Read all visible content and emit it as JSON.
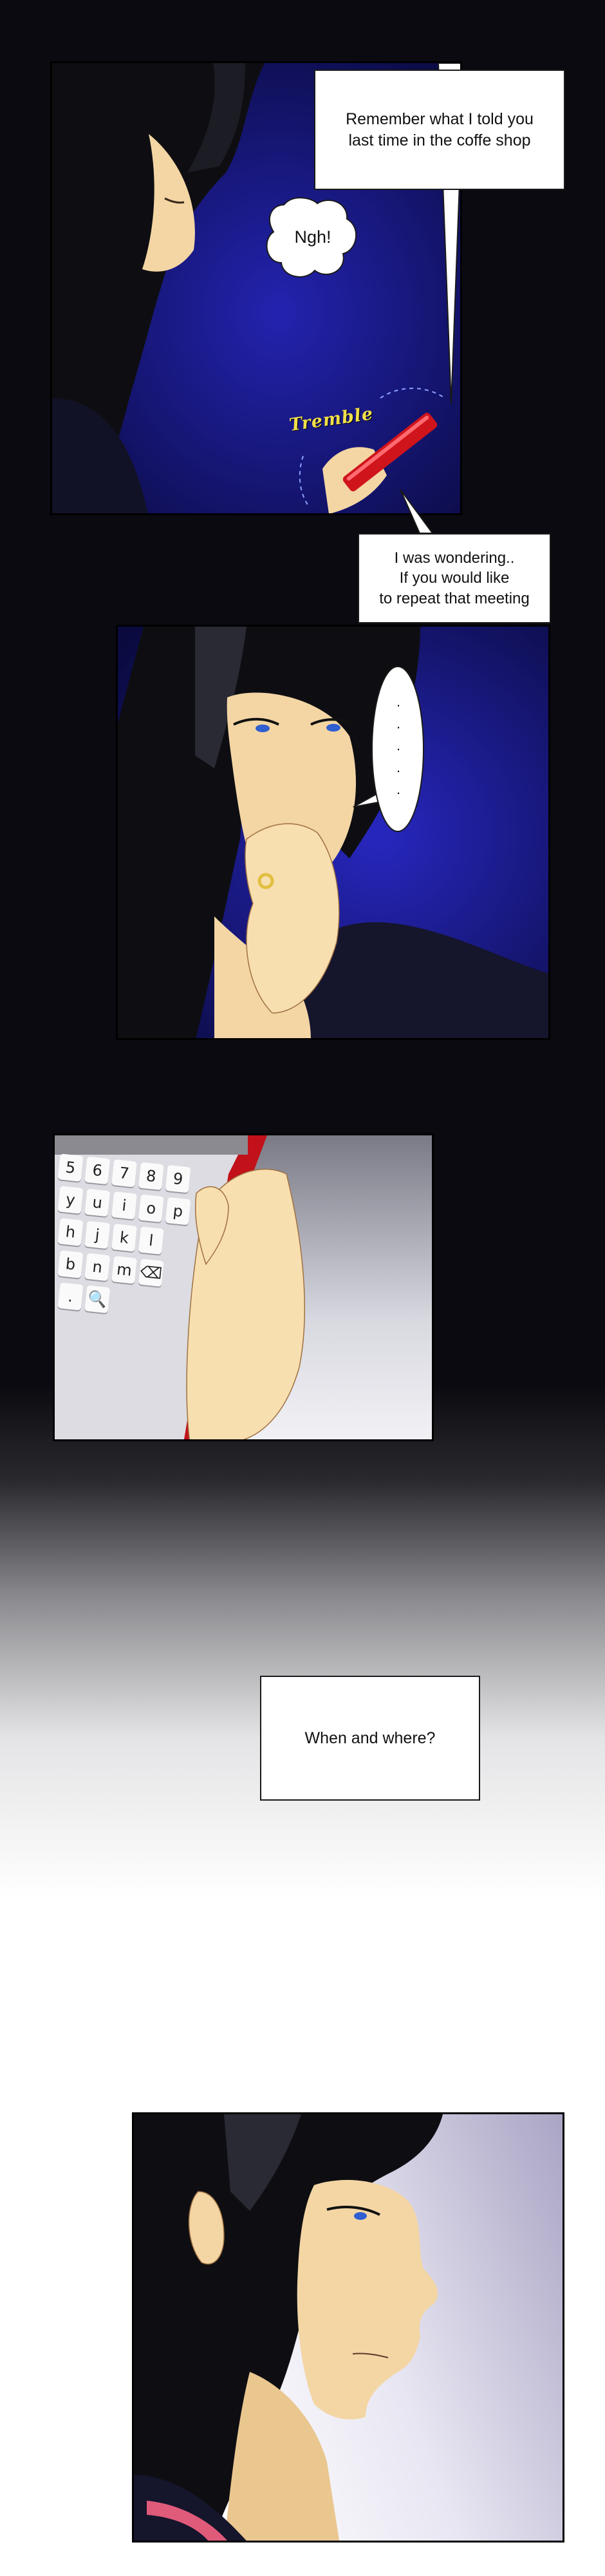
{
  "panel1": {
    "caption": "Remember what I told you\nlast time in the coffe shop",
    "speech": "Ngh!",
    "sfx": "Tremble"
  },
  "caption2": "I was wondering..\nIf you would like\nto repeat that meeting",
  "panel2": {
    "speech": ".\n.\n.\n.\n."
  },
  "panel3": {
    "keyboard_rows": [
      [
        "5",
        "6",
        "7",
        "8",
        "9"
      ],
      [
        "y",
        "u",
        "i",
        "o",
        "p"
      ],
      [
        "h",
        "j",
        "k",
        "l"
      ],
      [
        "b",
        "n",
        "m",
        "⌫"
      ],
      [
        ".",
        "🔍"
      ]
    ]
  },
  "caption3": "When and where?"
}
